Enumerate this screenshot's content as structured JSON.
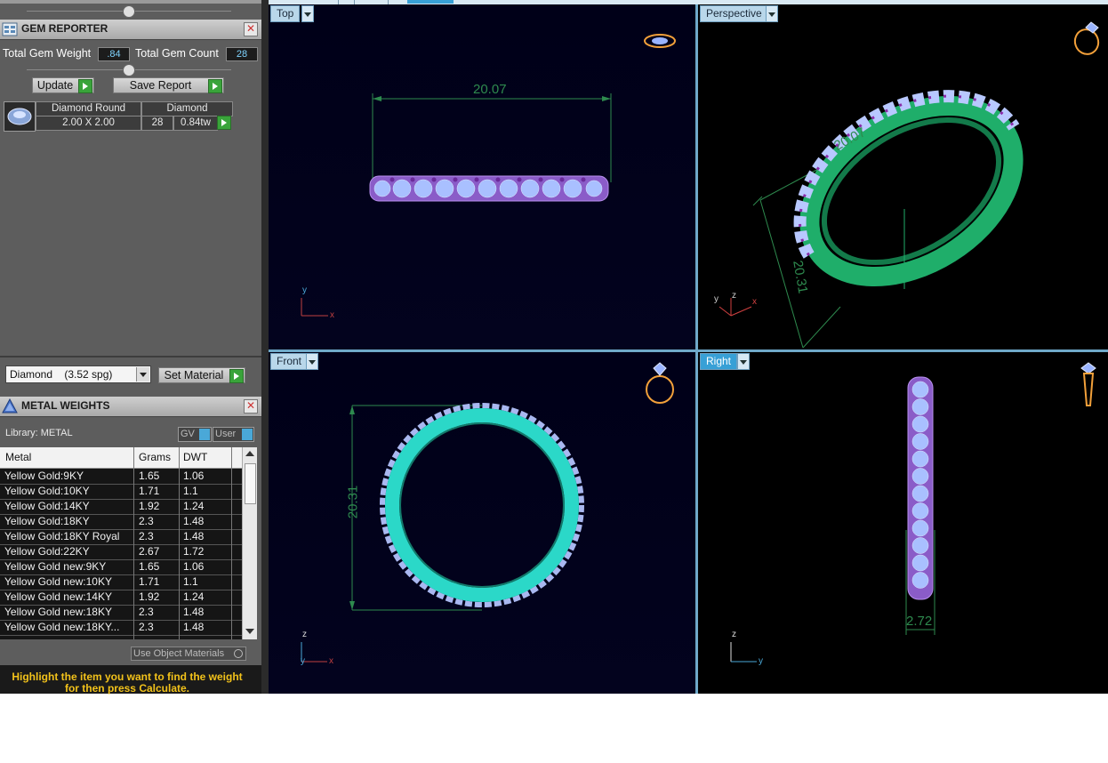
{
  "gem_reporter": {
    "title": "GEM REPORTER",
    "total_weight_label": "Total Gem Weight",
    "total_weight_value": ".84",
    "total_count_label": "Total Gem Count",
    "total_count_value": "28",
    "update_label": "Update",
    "save_report_label": "Save Report",
    "gem": {
      "header_shape": "Diamond Round",
      "header_material": "Diamond",
      "size": "2.00 X 2.00",
      "count": "28",
      "weight": "0.84tw"
    },
    "material_select": "Diamond    (3.52 spg)",
    "set_material_label": "Set Material"
  },
  "metal_weights": {
    "title": "METAL WEIGHTS",
    "library_label": "Library: METAL",
    "gv_label": "GV",
    "user_label": "User",
    "columns": [
      "Metal",
      "Grams",
      "DWT"
    ],
    "rows": [
      [
        "Yellow Gold:9KY",
        "1.65",
        "1.06"
      ],
      [
        "Yellow Gold:10KY",
        "1.71",
        "1.1"
      ],
      [
        "Yellow Gold:14KY",
        "1.92",
        "1.24"
      ],
      [
        "Yellow Gold:18KY",
        "2.3",
        "1.48"
      ],
      [
        "Yellow Gold:18KY Royal",
        "2.3",
        "1.48"
      ],
      [
        "Yellow Gold:22KY",
        "2.67",
        "1.72"
      ],
      [
        "Yellow Gold new:9KY",
        "1.65",
        "1.06"
      ],
      [
        "Yellow Gold new:10KY",
        "1.71",
        "1.1"
      ],
      [
        "Yellow Gold new:14KY",
        "1.92",
        "1.24"
      ],
      [
        "Yellow Gold new:18KY",
        "2.3",
        "1.48"
      ],
      [
        "Yellow Gold new:18KY...",
        "2.3",
        "1.48"
      ]
    ],
    "use_object_materials_label": "Use Object Materials",
    "hint_line1": "Highlight the item you want to find the weight",
    "hint_line2": "for then press Calculate."
  },
  "viewports": {
    "top": {
      "label": "Top",
      "dimension": "20.07",
      "axis_a": "y",
      "axis_b": "x"
    },
    "perspective": {
      "label": "Perspective",
      "dimension_a": "20.07",
      "dimension_b": "20.31",
      "axis_a": "y",
      "axis_b": "z",
      "axis_c": "x"
    },
    "front": {
      "label": "Front",
      "dimension": "20.31",
      "axis_a": "z",
      "axis_b": "y",
      "axis_c": "x"
    },
    "right": {
      "label": "Right",
      "dimension": "2.72",
      "axis_a": "z",
      "axis_b": "y"
    }
  },
  "icons": [
    "gem-reporter-icon",
    "metal-weights-icon",
    "close-icon",
    "play-icon",
    "dropdown-icon",
    "ring-preview-icon",
    "axis-gizmo-icon"
  ],
  "colors": {
    "viewport_bg": "#000018",
    "ring_metal": "#2bd8c8",
    "gem_fill": "#a9c0ff",
    "gem_prong": "#8a2aa8",
    "dimension": "#2e8a4e",
    "active_tab": "#38a0d6"
  }
}
